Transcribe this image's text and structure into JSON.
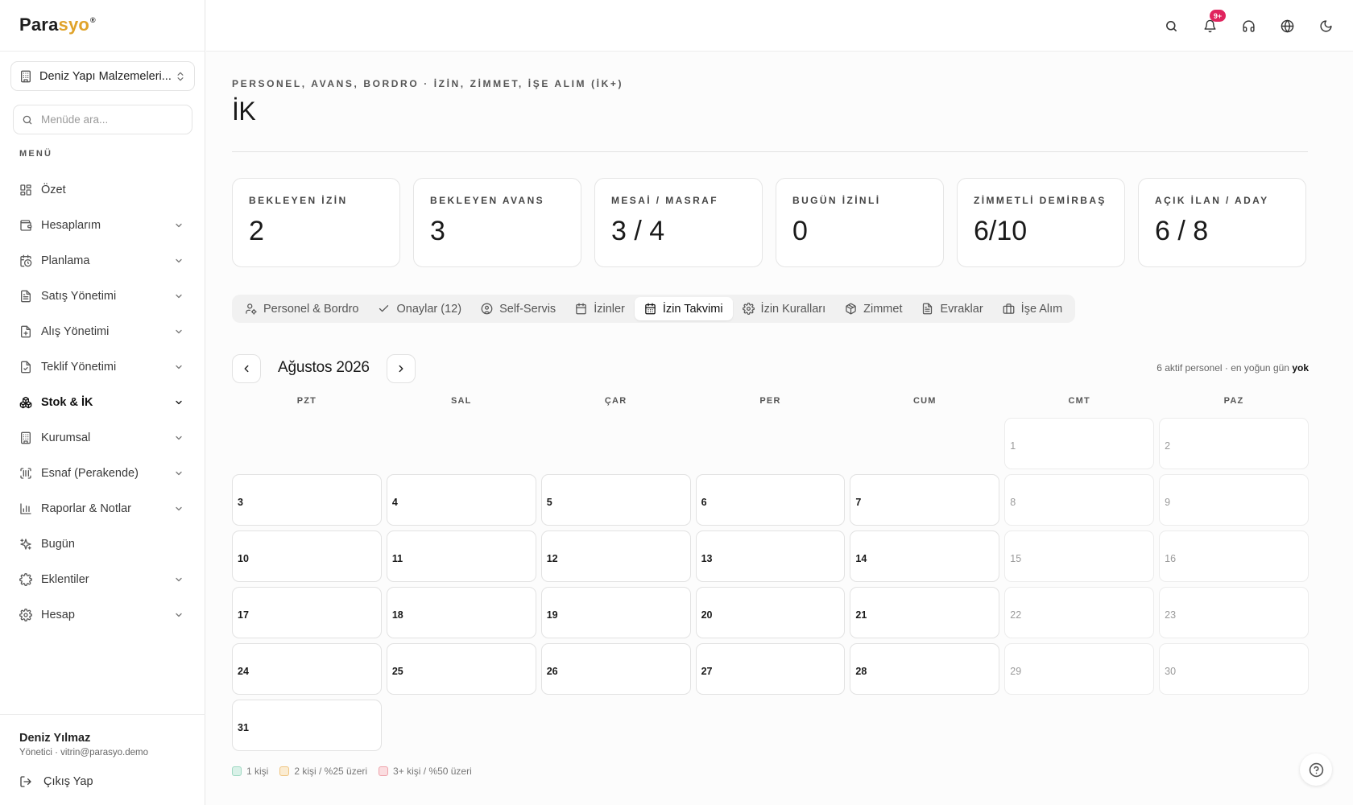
{
  "brand": {
    "part1": "Para",
    "part2": "syo",
    "mark": "®"
  },
  "sidebar": {
    "company": "Deniz Yapı Malzemeleri...",
    "search_placeholder": "Menüde ara...",
    "menu_label": "MENÜ",
    "items": [
      {
        "label": "Özet",
        "icon": "grid-icon",
        "chevron": false,
        "active": false
      },
      {
        "label": "Hesaplarım",
        "icon": "wallet-icon",
        "chevron": true,
        "active": false
      },
      {
        "label": "Planlama",
        "icon": "calendar-clock-icon",
        "chevron": true,
        "active": false
      },
      {
        "label": "Satış Yönetimi",
        "icon": "document-icon",
        "chevron": true,
        "active": false
      },
      {
        "label": "Alış Yönetimi",
        "icon": "document-plus-icon",
        "chevron": true,
        "active": false
      },
      {
        "label": "Teklif Yönetimi",
        "icon": "document-check-icon",
        "chevron": true,
        "active": false
      },
      {
        "label": "Stok & İK",
        "icon": "boxes-icon",
        "chevron": true,
        "active": true
      },
      {
        "label": "Kurumsal",
        "icon": "building-icon",
        "chevron": true,
        "active": false
      },
      {
        "label": "Esnaf (Perakende)",
        "icon": "scan-barcode-icon",
        "chevron": true,
        "active": false
      },
      {
        "label": "Raporlar & Notlar",
        "icon": "bar-chart-icon",
        "chevron": true,
        "active": false
      },
      {
        "label": "Bugün",
        "icon": "sparkles-icon",
        "chevron": false,
        "active": false
      },
      {
        "label": "Eklentiler",
        "icon": "puzzle-icon",
        "chevron": true,
        "active": false
      },
      {
        "label": "Hesap",
        "icon": "gear-icon",
        "chevron": true,
        "active": false
      }
    ],
    "user": {
      "name": "Deniz Yılmaz",
      "sub": "Yönetici · vitrin@parasyo.demo"
    },
    "logout": "Çıkış Yap"
  },
  "topbar": {
    "notification_badge": "9+",
    "icons": [
      "search-icon",
      "bell-icon",
      "headset-icon",
      "globe-icon",
      "moon-icon"
    ]
  },
  "page": {
    "eyebrow": "PERSONEL, AVANS, BORDRO · İZİN, ZİMMET, İŞE ALIM (İK+)",
    "title": "İK"
  },
  "stats": [
    {
      "label": "BEKLEYEN İZİN",
      "value": "2"
    },
    {
      "label": "BEKLEYEN AVANS",
      "value": "3"
    },
    {
      "label": "MESAİ / MASRAF",
      "value": "3 / 4"
    },
    {
      "label": "BUGÜN İZİNLİ",
      "value": "0"
    },
    {
      "label": "ZİMMETLİ DEMİRBAŞ",
      "value": "6/10"
    },
    {
      "label": "AÇIK İLAN / ADAY",
      "value": "6 / 8"
    }
  ],
  "tabs": [
    {
      "label": "Personel & Bordro",
      "icon": "user-cog-icon",
      "active": false
    },
    {
      "label": "Onaylar (12)",
      "icon": "check-icon",
      "active": false
    },
    {
      "label": "Self-Servis",
      "icon": "user-circle-icon",
      "active": false
    },
    {
      "label": "İzinler",
      "icon": "calendar-icon",
      "active": false
    },
    {
      "label": "İzin Takvimi",
      "icon": "calendar-days-icon",
      "active": true
    },
    {
      "label": "İzin Kuralları",
      "icon": "gear-icon",
      "active": false
    },
    {
      "label": "Zimmet",
      "icon": "package-icon",
      "active": false
    },
    {
      "label": "Evraklar",
      "icon": "file-text-icon",
      "active": false
    },
    {
      "label": "İşe Alım",
      "icon": "briefcase-icon",
      "active": false
    }
  ],
  "calendar": {
    "month": "Ağustos 2026",
    "info_prefix": "6 aktif personel · en yoğun gün",
    "info_value": "yok",
    "weekdays": [
      "PZT",
      "SAL",
      "ÇAR",
      "PER",
      "CUM",
      "CMT",
      "PAZ"
    ],
    "leading_blanks": 5,
    "days": 31,
    "legend": [
      {
        "label": "1 kişi",
        "color": "#d9f1e8",
        "border": "#9fd8c2"
      },
      {
        "label": "2 kişi / %25 üzeri",
        "color": "#fbecd2",
        "border": "#efc582"
      },
      {
        "label": "3+ kişi / %50 üzeri",
        "color": "#fbdde0",
        "border": "#eea3ab"
      }
    ]
  }
}
